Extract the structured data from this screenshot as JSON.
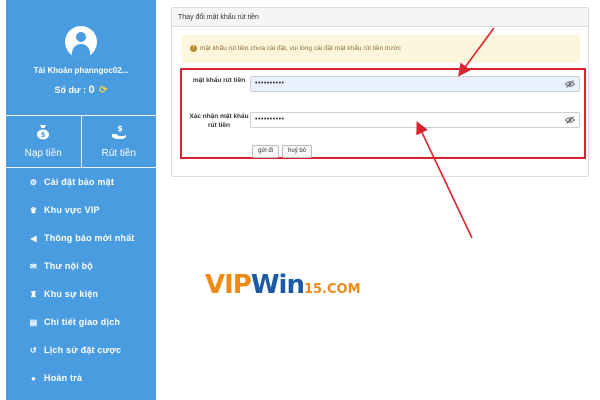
{
  "sidebar": {
    "account_label": "Tài Khoản phanngoc02...",
    "balance_label": "Số dư :",
    "balance_value": "0",
    "actions": [
      {
        "label": "Nạp tiền",
        "icon": "money-bag-icon"
      },
      {
        "label": "Rút tiền",
        "icon": "hand-money-icon"
      }
    ],
    "menu": [
      {
        "label": "Cài đặt bảo mật",
        "icon": "gear-icon"
      },
      {
        "label": "Khu vực VIP",
        "icon": "crown-icon"
      },
      {
        "label": "Thông báo mới nhất",
        "icon": "megaphone-icon"
      },
      {
        "label": "Thư nội bộ",
        "icon": "envelope-icon"
      },
      {
        "label": "Khu sự kiện",
        "icon": "trophy-icon"
      },
      {
        "label": "Chi tiết giao dịch",
        "icon": "clipboard-icon"
      },
      {
        "label": "Lịch sử đặt cược",
        "icon": "history-icon"
      },
      {
        "label": "Hoàn trả",
        "icon": "refund-icon"
      }
    ]
  },
  "panel": {
    "title": "Thay đổi mật khẩu rút tiền",
    "alert": "mật khẩu rút tiền chưa cài đặt, vui lòng cài đặt mật khẩu rút tiền trước",
    "fields": [
      {
        "label": "mật khẩu rút tiền",
        "value": "••••••••••"
      },
      {
        "label": "Xác nhận mật khẩu rút tiền",
        "value": "••••••••••"
      }
    ],
    "submit_label": "gửi đi",
    "cancel_label": "huỷ bỏ"
  },
  "logo": {
    "part1": "VIP",
    "part2": "Win",
    "part3": "15.COM"
  },
  "colors": {
    "sidebar": "#4a9ce0",
    "highlight": "#d9232e",
    "alert_bg": "#fdf6dd"
  }
}
